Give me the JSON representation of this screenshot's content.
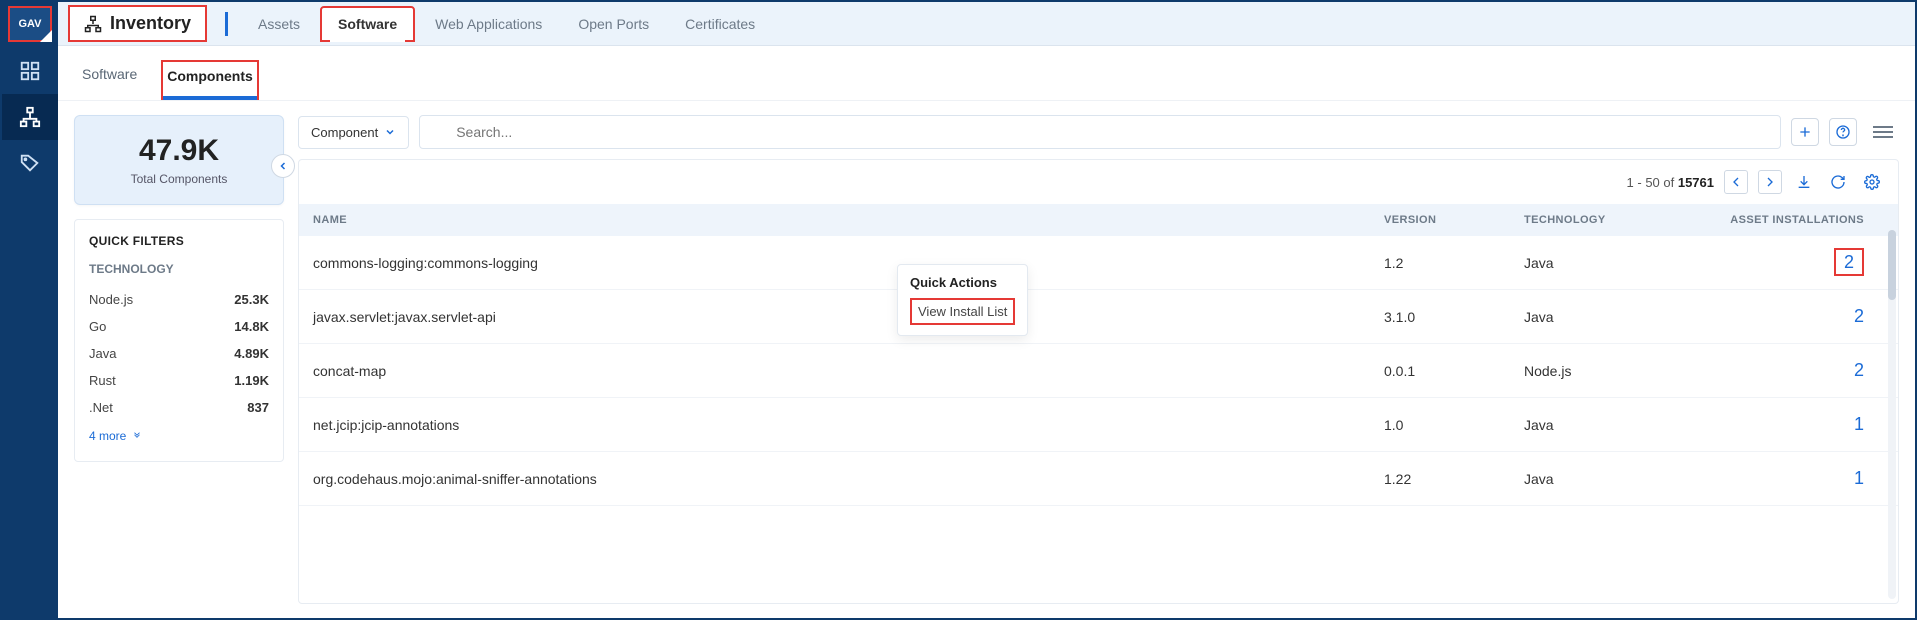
{
  "rail": {
    "badge": "GAV"
  },
  "header": {
    "inventory": "Inventory",
    "tabs": [
      "Assets",
      "Software",
      "Web Applications",
      "Open Ports",
      "Certificates"
    ],
    "active_tab": "Software"
  },
  "subtabs": {
    "items": [
      "Software",
      "Components"
    ],
    "active": "Components"
  },
  "summary": {
    "count": "47.9K",
    "label": "Total Components"
  },
  "filters": {
    "heading": "QUICK FILTERS",
    "group": "TECHNOLOGY",
    "items": [
      {
        "label": "Node.js",
        "count": "25.3K"
      },
      {
        "label": "Go",
        "count": "14.8K"
      },
      {
        "label": "Java",
        "count": "4.89K"
      },
      {
        "label": "Rust",
        "count": "1.19K"
      },
      {
        "label": ".Net",
        "count": "837"
      }
    ],
    "more": "4 more"
  },
  "search": {
    "dropdown": "Component",
    "placeholder": "Search..."
  },
  "toolbar": {
    "range_prefix": "1 - 50 of ",
    "total": "15761"
  },
  "table": {
    "headers": {
      "name": "NAME",
      "version": "VERSION",
      "technology": "TECHNOLOGY",
      "installs": "ASSET INSTALLATIONS"
    },
    "rows": [
      {
        "name": "commons-logging:commons-logging",
        "version": "1.2",
        "technology": "Java",
        "installs": "2",
        "highlight": true
      },
      {
        "name": "javax.servlet:javax.servlet-api",
        "version": "3.1.0",
        "technology": "Java",
        "installs": "2"
      },
      {
        "name": "concat-map",
        "version": "0.0.1",
        "technology": "Node.js",
        "installs": "2"
      },
      {
        "name": "net.jcip:jcip-annotations",
        "version": "1.0",
        "technology": "Java",
        "installs": "1"
      },
      {
        "name": "org.codehaus.mojo:animal-sniffer-annotations",
        "version": "1.22",
        "technology": "Java",
        "installs": "1"
      }
    ]
  },
  "popover": {
    "title": "Quick Actions",
    "action": "View Install List"
  }
}
